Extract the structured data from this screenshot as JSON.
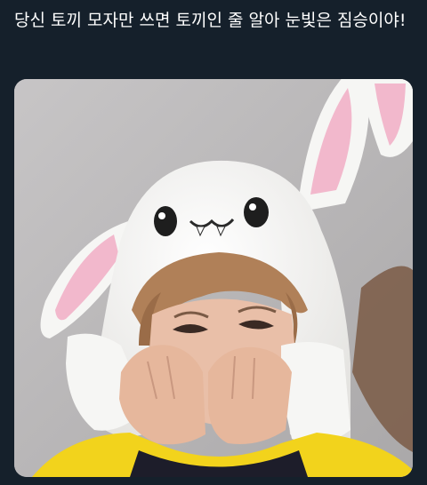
{
  "tweet": {
    "text": "당신 토끼 모자만 쓰면 토끼인 줄 알아 눈빛은 짐승이야!"
  },
  "media": {
    "icon": "photo",
    "colors": {
      "background": "#15202b",
      "text": "#ffffff",
      "wall": "#b9b7b8",
      "hat": "#f6f6f4",
      "ear_pink": "#f2b8cc",
      "hair": "#b08058",
      "skin": "#e9bfa8",
      "jacket_yellow": "#f2d31c"
    }
  }
}
